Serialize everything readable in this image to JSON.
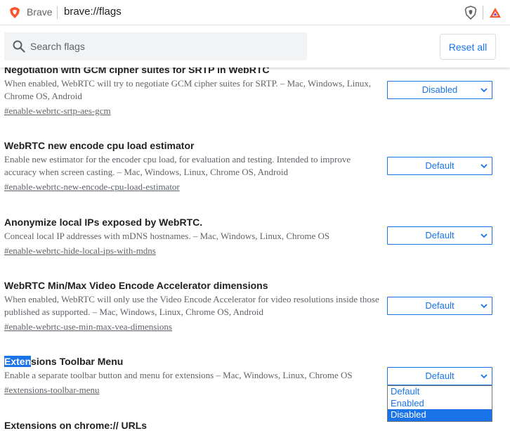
{
  "browser": {
    "name": "Brave",
    "url": "brave://flags"
  },
  "header": {
    "search_placeholder": "Search flags",
    "reset_label": "Reset all"
  },
  "experiments": [
    {
      "title": "Negotiation with GCM cipher suites for SRTP in WebRTC",
      "description": "When enabled, WebRTC will try to negotiate GCM cipher suites for SRTP. – Mac, Windows, Linux, Chrome OS, Android",
      "link": "#enable-webrtc-srtp-aes-gcm",
      "value": "Disabled"
    },
    {
      "title": "WebRTC new encode cpu load estimator",
      "description": "Enable new estimator for the encoder cpu load, for evaluation and testing. Intended to improve accuracy when screen casting. – Mac, Windows, Linux, Chrome OS, Android",
      "link": "#enable-webrtc-new-encode-cpu-load-estimator",
      "value": "Default"
    },
    {
      "title": "Anonymize local IPs exposed by WebRTC.",
      "description": "Conceal local IP addresses with mDNS hostnames. – Mac, Windows, Linux, Chrome OS",
      "link": "#enable-webrtc-hide-local-ips-with-mdns",
      "value": "Default"
    },
    {
      "title": "WebRTC Min/Max Video Encode Accelerator dimensions",
      "description": "When enabled, WebRTC will only use the Video Encode Accelerator for video resolutions inside those published as supported. – Mac, Windows, Linux, Chrome OS, Android",
      "link": "#enable-webrtc-use-min-max-vea-dimensions",
      "value": "Default"
    },
    {
      "title_highlight": "Exten",
      "title_rest": "sions Toolbar Menu",
      "description": "Enable a separate toolbar button and menu for extensions – Mac, Windows, Linux, Chrome OS",
      "link": "#extensions-toolbar-menu",
      "value": "Default"
    },
    {
      "title": "Extensions on chrome:// URLs"
    }
  ],
  "dropdown_options": [
    "Default",
    "Enabled",
    "Disabled"
  ],
  "dropdown_highlighted": "Disabled",
  "colors": {
    "accent": "#1a73e8",
    "brave_orange": "#fb542b"
  }
}
